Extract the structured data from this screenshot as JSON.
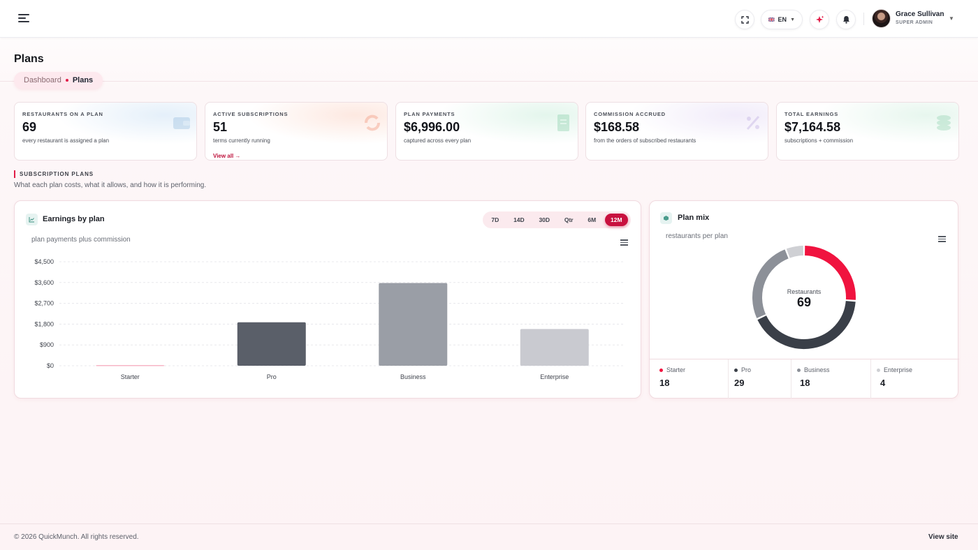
{
  "header": {
    "lang": "EN",
    "user_name": "Grace Sullivan",
    "user_role": "SUPER ADMIN"
  },
  "page": {
    "title": "Plans",
    "breadcrumb": [
      "Dashboard",
      "Plans"
    ]
  },
  "stats": [
    {
      "label": "RESTAURANTS ON A PLAN",
      "value": "69",
      "sub": "every restaurant is assigned a plan",
      "tint": "#cfe3f5",
      "icon": "wallet-icon"
    },
    {
      "label": "ACTIVE SUBSCRIPTIONS",
      "value": "51",
      "sub": "terms currently running",
      "link": "View all →",
      "tint": "#fbd6c8",
      "icon": "refresh-icon"
    },
    {
      "label": "PLAN PAYMENTS",
      "value": "$6,996.00",
      "sub": "captured across every plan",
      "tint": "#cdeedd",
      "icon": "receipt-icon"
    },
    {
      "label": "COMMISSION ACCRUED",
      "value": "$168.58",
      "sub": "from the orders of subscribed restaurants",
      "tint": "#e6dcf5",
      "icon": "percent-icon"
    },
    {
      "label": "TOTAL EARNINGS",
      "value": "$7,164.58",
      "sub": "subscriptions + commission",
      "tint": "#d3efe0",
      "icon": "coins-icon"
    }
  ],
  "section": {
    "title": "SUBSCRIPTION PLANS",
    "desc": "What each plan costs, what it allows, and how it is performing."
  },
  "earnings": {
    "title": "Earnings by plan",
    "subtitle": "plan payments plus commission",
    "ranges": [
      "7D",
      "14D",
      "30D",
      "Qtr",
      "6M",
      "12M"
    ],
    "active_range": "12M"
  },
  "mix": {
    "title": "Plan mix",
    "subtitle": "restaurants per plan",
    "center_label": "Restaurants",
    "center_value": "69",
    "legend": [
      {
        "name": "Starter",
        "value": "18",
        "color": "#f0133f"
      },
      {
        "name": "Pro",
        "value": "29",
        "color": "#3a3f48"
      },
      {
        "name": "Business",
        "value": "18",
        "color": "#8c9098"
      },
      {
        "name": "Enterprise",
        "value": "4",
        "color": "#cfd0d4"
      }
    ]
  },
  "chart_data": [
    {
      "type": "bar",
      "title": "Earnings by plan",
      "subtitle": "plan payments plus commission",
      "categories": [
        "Starter",
        "Pro",
        "Business",
        "Enterprise"
      ],
      "values": [
        30,
        1880,
        3580,
        1590
      ],
      "colors": [
        "#f7b6c6",
        "#5a5f69",
        "#9a9ea6",
        "#c9cad0"
      ],
      "ylim": [
        0,
        4500
      ],
      "yticks": [
        "$0",
        "$900",
        "$1,800",
        "$2,700",
        "$3,600",
        "$4,500"
      ],
      "ytick_values": [
        0,
        900,
        1800,
        2700,
        3600,
        4500
      ],
      "grid": true
    },
    {
      "type": "pie",
      "title": "Plan mix",
      "subtitle": "restaurants per plan",
      "categories": [
        "Starter",
        "Pro",
        "Business",
        "Enterprise"
      ],
      "values": [
        18,
        29,
        18,
        4
      ],
      "colors": [
        "#f0133f",
        "#3a3f48",
        "#8c9098",
        "#cfd0d4"
      ],
      "total_label": "Restaurants",
      "total": 69
    }
  ],
  "footer": {
    "copyright": "© 2026 QuickMunch. All rights reserved.",
    "view_site": "View site"
  }
}
